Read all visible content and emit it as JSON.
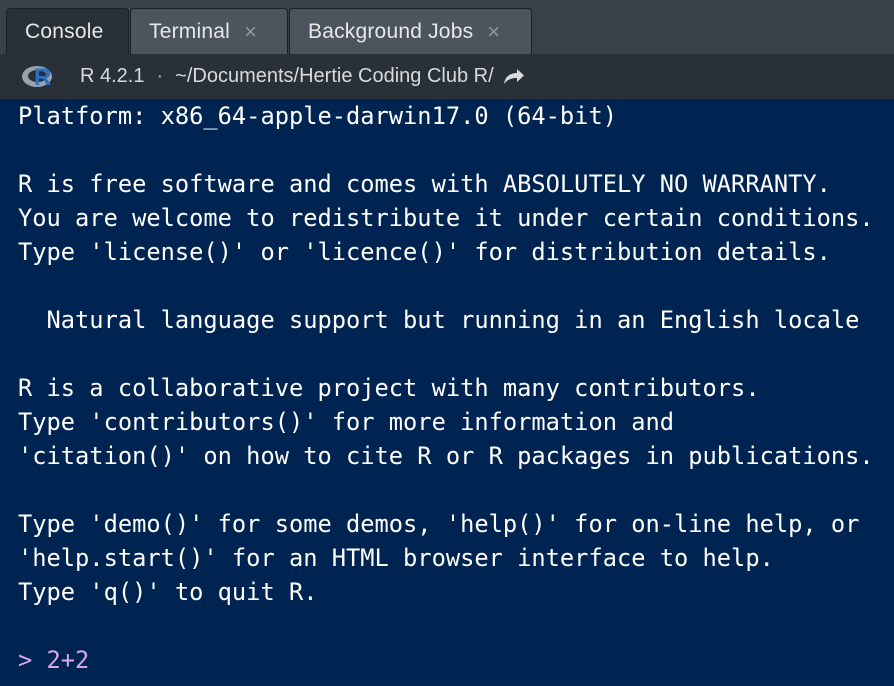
{
  "tabs": [
    {
      "label": "Console",
      "active": true,
      "closable": false
    },
    {
      "label": "Terminal",
      "active": false,
      "closable": true
    },
    {
      "label": "Background Jobs",
      "active": false,
      "closable": true
    }
  ],
  "close_glyph": "×",
  "pathbar": {
    "logo_letter": "R",
    "r_version": "R 4.2.1",
    "separator": "·",
    "working_directory": "~/Documents/Hertie Coding Club R/",
    "goto_icon": "arrow-forward-icon"
  },
  "console": {
    "output": "Platform: x86_64-apple-darwin17.0 (64-bit)\n\nR is free software and comes with ABSOLUTELY NO WARRANTY.\nYou are welcome to redistribute it under certain conditions.\nType 'license()' or 'licence()' for distribution details.\n\n  Natural language support but running in an English locale\n\nR is a collaborative project with many contributors.\nType 'contributors()' for more information and\n'citation()' on how to cite R or R packages in publications.\n\nType 'demo()' for some demos, 'help()' for on-line help, or\n'help.start()' for an HTML browser interface to help.\nType 'q()' to quit R.",
    "prompt": ">",
    "input": "2+2"
  },
  "colors": {
    "console_bg": "#002451",
    "console_text": "#ffffff",
    "prompt_text": "#d6a6f0",
    "tabbar_bg": "#3a4048",
    "active_tab_bg": "#2a3037"
  }
}
